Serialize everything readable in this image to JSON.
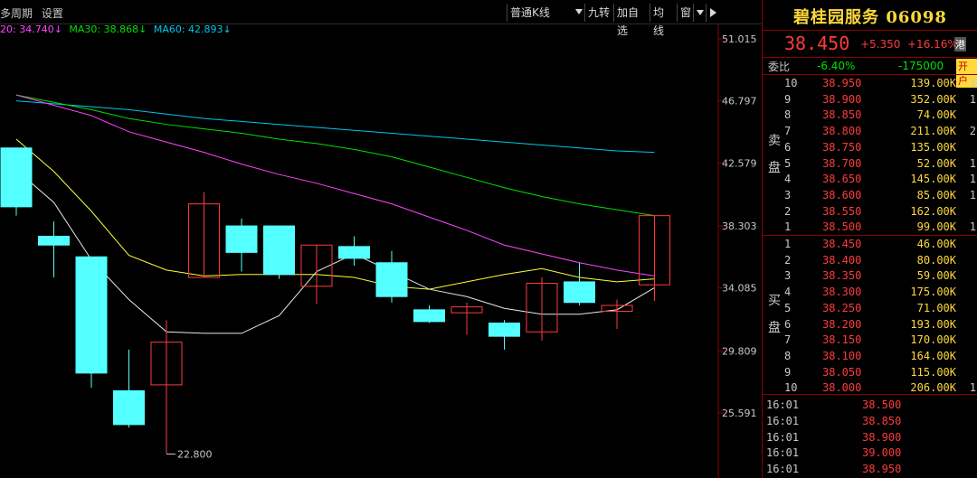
{
  "topbar": {
    "left_items": [
      "多周期",
      "设置"
    ],
    "buttons": [
      "普通K线",
      "九转",
      "加自选",
      "均线",
      "窗"
    ],
    "dropdown_icon": "dropdown-arrow-icon"
  },
  "ma_legend": {
    "ma20": "20: 34.740↓",
    "ma30": "MA30: 38.868↓",
    "ma60": "MA60: 42.893↓",
    "colors": {
      "ma20": "#ff44ff",
      "ma30": "#00e000",
      "ma60": "#00c8e8"
    }
  },
  "chart_data": {
    "type": "candlestick",
    "y_ticks": [
      "51.015",
      "46.797",
      "42.579",
      "38.303",
      "34.085",
      "29.809",
      "25.591"
    ],
    "low_annotation": "22.800",
    "candles": [
      {
        "open": 43.6,
        "close": 39.6,
        "high": 43.6,
        "low": 39.0
      },
      {
        "open": 37.6,
        "close": 37.0,
        "high": 38.6,
        "low": 34.8
      },
      {
        "open": 36.2,
        "close": 28.3,
        "high": 36.2,
        "low": 27.3
      },
      {
        "open": 27.1,
        "close": 24.8,
        "high": 29.9,
        "low": 24.6
      },
      {
        "open": 27.5,
        "close": 30.4,
        "high": 31.9,
        "low": 22.8
      },
      {
        "open": 34.8,
        "close": 39.8,
        "high": 40.6,
        "low": 34.8
      },
      {
        "open": 38.3,
        "close": 36.5,
        "high": 38.8,
        "low": 35.2
      },
      {
        "open": 38.3,
        "close": 35.0,
        "high": 38.3,
        "low": 34.7
      },
      {
        "open": 34.2,
        "close": 37.0,
        "high": 37.0,
        "low": 33.0
      },
      {
        "open": 36.9,
        "close": 36.1,
        "high": 37.6,
        "low": 35.6
      },
      {
        "open": 35.8,
        "close": 33.5,
        "high": 36.6,
        "low": 33.1
      },
      {
        "open": 32.6,
        "close": 31.8,
        "high": 32.9,
        "low": 31.7
      },
      {
        "open": 32.4,
        "close": 32.8,
        "high": 33.1,
        "low": 30.9
      },
      {
        "open": 31.7,
        "close": 30.8,
        "high": 31.9,
        "low": 29.9
      },
      {
        "open": 31.1,
        "close": 34.4,
        "high": 34.8,
        "low": 30.5
      },
      {
        "open": 34.5,
        "close": 33.1,
        "high": 35.8,
        "low": 32.9
      },
      {
        "open": 32.5,
        "close": 32.9,
        "high": 33.3,
        "low": 31.3
      },
      {
        "open": 34.3,
        "close": 39.0,
        "high": 39.0,
        "low": 33.2
      }
    ],
    "ma5": [
      42.1,
      39.9,
      36.0,
      33.3,
      31.1,
      31.0,
      31.0,
      32.2,
      35.2,
      36.4,
      35.2,
      34.0,
      33.5,
      32.7,
      32.3,
      32.3,
      32.6,
      34.1
    ],
    "ma10": [
      44.2,
      42.0,
      39.3,
      36.3,
      35.3,
      34.9,
      35.0,
      35.0,
      35.0,
      34.8,
      34.2,
      34.0,
      34.5,
      35.0,
      35.4,
      34.8,
      34.5,
      34.7
    ],
    "ma20": [
      47.2,
      46.5,
      45.8,
      44.7,
      44.0,
      43.3,
      42.5,
      41.8,
      41.2,
      40.5,
      39.8,
      38.9,
      38.0,
      37.0,
      36.4,
      35.8,
      35.3,
      34.9
    ],
    "ma30": [
      47.2,
      46.7,
      46.2,
      45.6,
      45.2,
      44.9,
      44.6,
      44.2,
      43.9,
      43.5,
      43.0,
      42.3,
      41.6,
      40.9,
      40.3,
      39.8,
      39.4,
      39.0
    ],
    "ma60": [
      46.8,
      46.6,
      46.4,
      46.2,
      45.9,
      45.6,
      45.4,
      45.2,
      45.0,
      44.8,
      44.6,
      44.4,
      44.2,
      44.0,
      43.8,
      43.6,
      43.4,
      43.3
    ],
    "colors": {
      "up": "#ff3b3b",
      "down": "#54ffff",
      "ma5": "#e8e8e8",
      "ma10": "#ffff33",
      "ma20": "#ff44ff",
      "ma30": "#00e000",
      "ma60": "#00c8e8"
    },
    "ylim": [
      22.0,
      51.5
    ]
  },
  "quote": {
    "title": "碧桂园服务 06098",
    "last": "38.450",
    "change": "+5.350",
    "pct": "+16.16%",
    "badge": "港",
    "ratio_label": "委比",
    "ratio": "-6.40%",
    "diff": "-175000",
    "open_badge": "开户",
    "sell_label": "卖盘",
    "buy_label": "买盘"
  },
  "asks": [
    {
      "lvl": "10",
      "price": "38.950",
      "vol": "139.00K",
      "extra": "1"
    },
    {
      "lvl": "9",
      "price": "38.900",
      "vol": "352.00K",
      "extra": "1"
    },
    {
      "lvl": "8",
      "price": "38.850",
      "vol": "74.00K",
      "extra": ""
    },
    {
      "lvl": "7",
      "price": "38.800",
      "vol": "211.00K",
      "extra": "2"
    },
    {
      "lvl": "6",
      "price": "38.750",
      "vol": "135.00K",
      "extra": ""
    },
    {
      "lvl": "5",
      "price": "38.700",
      "vol": "52.00K",
      "extra": "1"
    },
    {
      "lvl": "4",
      "price": "38.650",
      "vol": "145.00K",
      "extra": "1"
    },
    {
      "lvl": "3",
      "price": "38.600",
      "vol": "85.00K",
      "extra": "1"
    },
    {
      "lvl": "2",
      "price": "38.550",
      "vol": "162.00K",
      "extra": ""
    },
    {
      "lvl": "1",
      "price": "38.500",
      "vol": "99.00K",
      "extra": "1"
    }
  ],
  "bids": [
    {
      "lvl": "1",
      "price": "38.450",
      "vol": "46.00K",
      "extra": ""
    },
    {
      "lvl": "2",
      "price": "38.400",
      "vol": "80.00K",
      "extra": ""
    },
    {
      "lvl": "3",
      "price": "38.350",
      "vol": "59.00K",
      "extra": ""
    },
    {
      "lvl": "4",
      "price": "38.300",
      "vol": "175.00K",
      "extra": ""
    },
    {
      "lvl": "5",
      "price": "38.250",
      "vol": "71.00K",
      "extra": ""
    },
    {
      "lvl": "6",
      "price": "38.200",
      "vol": "193.00K",
      "extra": ""
    },
    {
      "lvl": "7",
      "price": "38.150",
      "vol": "170.00K",
      "extra": ""
    },
    {
      "lvl": "8",
      "price": "38.100",
      "vol": "164.00K",
      "extra": ""
    },
    {
      "lvl": "9",
      "price": "38.050",
      "vol": "115.00K",
      "extra": ""
    },
    {
      "lvl": "10",
      "price": "38.000",
      "vol": "206.00K",
      "extra": "1"
    }
  ],
  "ticks": [
    {
      "time": "16:01",
      "price": "38.500"
    },
    {
      "time": "16:01",
      "price": "38.850"
    },
    {
      "time": "16:01",
      "price": "38.900"
    },
    {
      "time": "16:01",
      "price": "39.000"
    },
    {
      "time": "16:01",
      "price": "38.950"
    }
  ]
}
